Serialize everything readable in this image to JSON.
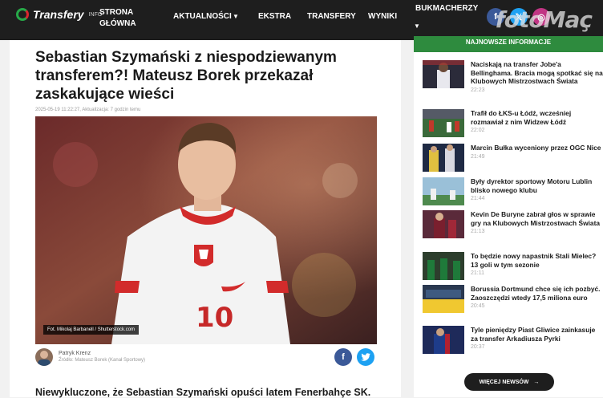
{
  "header": {
    "logo_text": "Transfery",
    "logo_sub": "INFO",
    "nav": [
      "STRONA",
      "GŁÓWNA",
      "AKTUALNOŚCI",
      "EKSTRA",
      "TRANSFERY",
      "WYNIKI",
      "BUKMACHERZY"
    ],
    "watermark": "fotoMaç"
  },
  "article": {
    "title": "Sebastian Szymański z niespodziewanym transferem?! Mateusz Borek przekazał zaskakujące wieści",
    "meta": "2025-05-19 11:22:27, Aktualizacja: 7 godzin temu",
    "photo_caption": "Fot. Mikolaj Barbanell / Shutterstock.com",
    "author_name": "Patryk Krenz",
    "author_source": "Źródło: Mateusz Borek (Kanał Sportowy)",
    "lead": "Niewykluczone, że Sebastian Szymański opuści latem Fenerbahçe SK."
  },
  "sidebar": {
    "header": "NAJNOWSZE INFORMACJE",
    "items": [
      {
        "title": "Naciskają na transfer Jobe'a Bellinghama. Bracia mogą spotkać się na Klubowych Mistrzostwach Świata",
        "time": "22:23"
      },
      {
        "title": "Trafił do ŁKS-u Łódź, wcześniej rozmawiał z nim Widzew Łódź",
        "time": "22:02"
      },
      {
        "title": "Marcin Bułka wyceniony przez OGC Nice",
        "time": "21:49"
      },
      {
        "title": "Były dyrektor sportowy Motoru Lublin blisko nowego klubu",
        "time": "21:44"
      },
      {
        "title": "Kevin De Buryne zabrał głos w sprawie gry na Klubowych Mistrzostwach Świata",
        "time": "21:13"
      },
      {
        "title": "To będzie nowy napastnik Stali Mielec? 13 goli w tym sezonie",
        "time": "21:11"
      },
      {
        "title": "Borussia Dortmund chce się ich pozbyć. Zaoszczędzi wtedy 17,5 miliona euro",
        "time": "20:45"
      },
      {
        "title": "Tyle pieniędzy Piast Gliwice zainkasuje za transfer Arkadiusza Pyrki",
        "time": "20:37"
      }
    ],
    "more_label": "WIĘCEJ NEWSÓW",
    "more_arrow": "→"
  },
  "colors": {
    "accent": "#2e8b3e",
    "dark": "#1e1e1e",
    "facebook": "#3b5998",
    "twitter": "#1da1f2",
    "instagram": "#c13584"
  }
}
